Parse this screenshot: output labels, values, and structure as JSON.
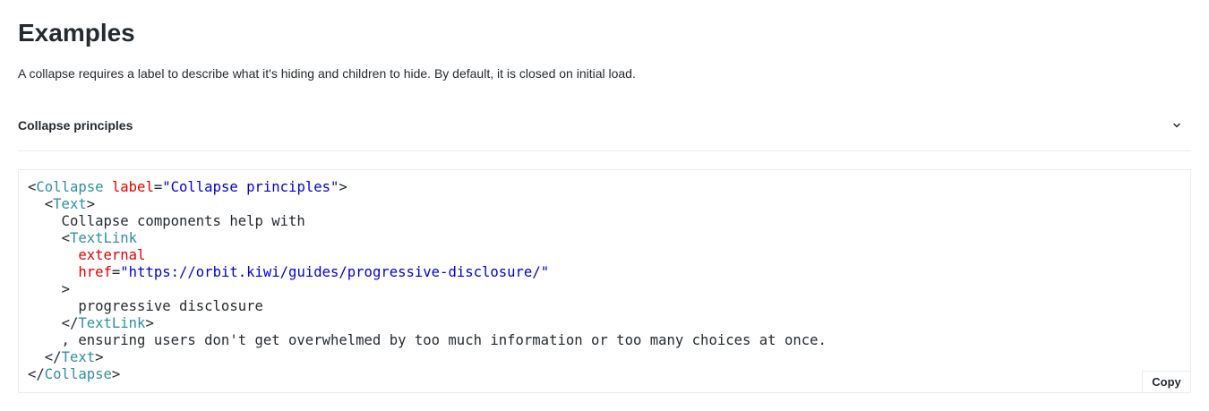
{
  "section": {
    "title": "Examples",
    "description": "A collapse requires a label to describe what it's hiding and children to hide. By default, it is closed on initial load."
  },
  "collapse": {
    "label": "Collapse principles",
    "icon": "chevron-down-icon",
    "expanded": false
  },
  "code_example": {
    "copy_label": "Copy",
    "colors": {
      "tag": "#2e8fa3",
      "attribute": "#e50000",
      "string": "#0000d6",
      "text": "#252a31"
    },
    "lines": [
      [
        {
          "t": "punc",
          "v": "<"
        },
        {
          "t": "tag",
          "v": "Collapse"
        },
        {
          "t": "text",
          "v": " "
        },
        {
          "t": "attr",
          "v": "label"
        },
        {
          "t": "punc",
          "v": "="
        },
        {
          "t": "str",
          "v": "\"Collapse principles\""
        },
        {
          "t": "punc",
          "v": ">"
        }
      ],
      [
        {
          "t": "text",
          "v": "  "
        },
        {
          "t": "punc",
          "v": "<"
        },
        {
          "t": "tag",
          "v": "Text"
        },
        {
          "t": "punc",
          "v": ">"
        }
      ],
      [
        {
          "t": "text",
          "v": "    Collapse components help with"
        }
      ],
      [
        {
          "t": "text",
          "v": "    "
        },
        {
          "t": "punc",
          "v": "<"
        },
        {
          "t": "tag",
          "v": "TextLink"
        }
      ],
      [
        {
          "t": "text",
          "v": "      "
        },
        {
          "t": "attr",
          "v": "external"
        }
      ],
      [
        {
          "t": "text",
          "v": "      "
        },
        {
          "t": "attr",
          "v": "href"
        },
        {
          "t": "punc",
          "v": "="
        },
        {
          "t": "str",
          "v": "\"https://orbit.kiwi/guides/progressive-disclosure/\""
        }
      ],
      [
        {
          "t": "text",
          "v": "    "
        },
        {
          "t": "punc",
          "v": ">"
        }
      ],
      [
        {
          "t": "text",
          "v": "      progressive disclosure"
        }
      ],
      [
        {
          "t": "text",
          "v": "    "
        },
        {
          "t": "punc",
          "v": "</"
        },
        {
          "t": "tag",
          "v": "TextLink"
        },
        {
          "t": "punc",
          "v": ">"
        }
      ],
      [
        {
          "t": "text",
          "v": "    , ensuring users don't get overwhelmed by too much information or too many choices at once."
        }
      ],
      [
        {
          "t": "text",
          "v": "  "
        },
        {
          "t": "punc",
          "v": "</"
        },
        {
          "t": "tag",
          "v": "Text"
        },
        {
          "t": "punc",
          "v": ">"
        }
      ],
      [
        {
          "t": "punc",
          "v": "</"
        },
        {
          "t": "tag",
          "v": "Collapse"
        },
        {
          "t": "punc",
          "v": ">"
        }
      ]
    ]
  }
}
